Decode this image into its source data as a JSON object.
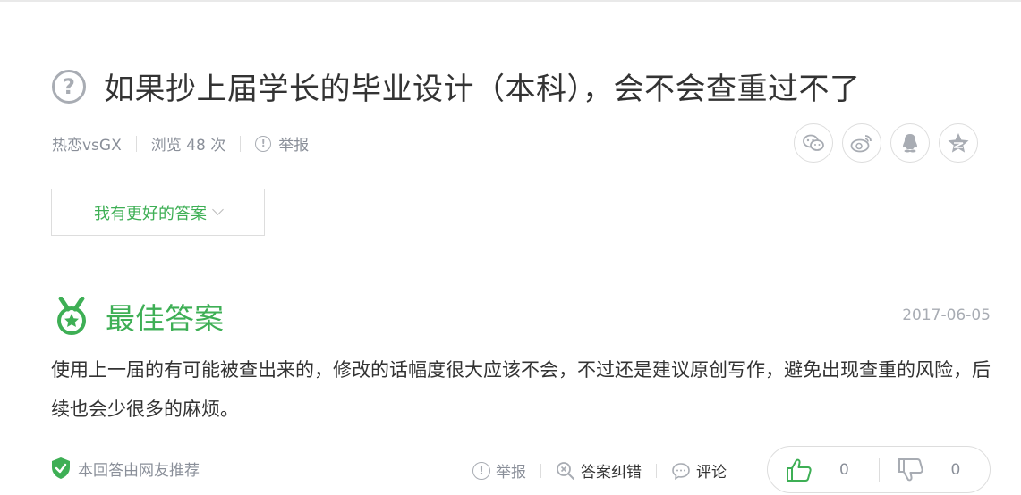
{
  "question": {
    "title": "如果抄上届学长的毕业设计（本科），会不会查重过不了",
    "author": "热恋vsGX",
    "views": "浏览 48 次",
    "report_label": "举报"
  },
  "share_icons": [
    "wechat-icon",
    "weibo-icon",
    "qq-icon",
    "qzone-icon"
  ],
  "better_answer_button": "我有更好的答案",
  "best_answer": {
    "label": "最佳答案",
    "date": "2017-06-05",
    "content": "使用上一届的有可能被查出来的，修改的话幅度很大应该不会，不过还是建议原创写作，避免出现查重的风险，后续也会少很多的麻烦。",
    "recommend_note": "本回答由网友推荐",
    "actions": {
      "report": "举报",
      "correct": "答案纠错",
      "comment": "评论"
    },
    "likes": "0",
    "dislikes": "0"
  },
  "colors": {
    "accent_green": "#3eaf55",
    "muted_gray": "#8a8f99",
    "border": "#dddddd"
  }
}
